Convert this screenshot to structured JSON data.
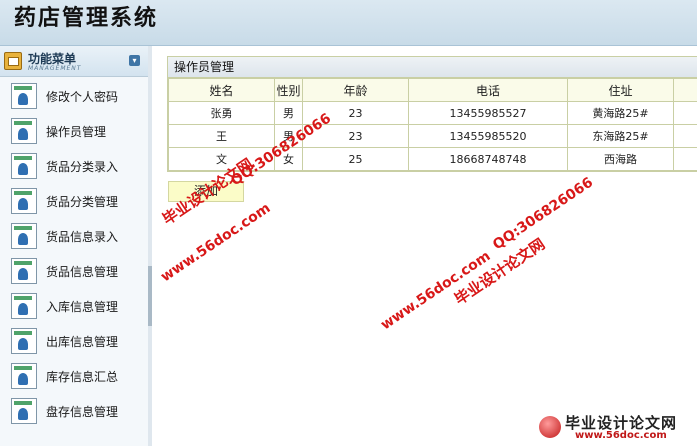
{
  "app": {
    "title": "药店管理系统"
  },
  "sidebar": {
    "header": {
      "title": "功能菜单",
      "subtitle": "MANAGEMENT"
    },
    "items": [
      {
        "label": "修改个人密码"
      },
      {
        "label": "操作员管理"
      },
      {
        "label": "货品分类录入"
      },
      {
        "label": "货品分类管理"
      },
      {
        "label": "货品信息录入"
      },
      {
        "label": "货品信息管理"
      },
      {
        "label": "入库信息管理"
      },
      {
        "label": "出库信息管理"
      },
      {
        "label": "库存信息汇总"
      },
      {
        "label": "盘存信息管理"
      }
    ]
  },
  "main": {
    "panel_title": "操作员管理",
    "columns": [
      "姓名",
      "性别",
      "年龄",
      "电话",
      "住址",
      ""
    ],
    "rows": [
      [
        "张勇",
        "男",
        "23",
        "13455985527",
        "黄海路25#",
        ""
      ],
      [
        "王",
        "男",
        "23",
        "13455985520",
        "东海路25#",
        ""
      ],
      [
        "文",
        "女",
        "25",
        "18668748748",
        "西海路",
        ""
      ]
    ],
    "add_button": "添加"
  },
  "watermarks": {
    "site": "www.56doc.com",
    "qq": "QQ:306826066",
    "brand": "毕业设计论文网",
    "logo_title": "毕业设计论文网",
    "logo_url": "www.56doc.com"
  }
}
